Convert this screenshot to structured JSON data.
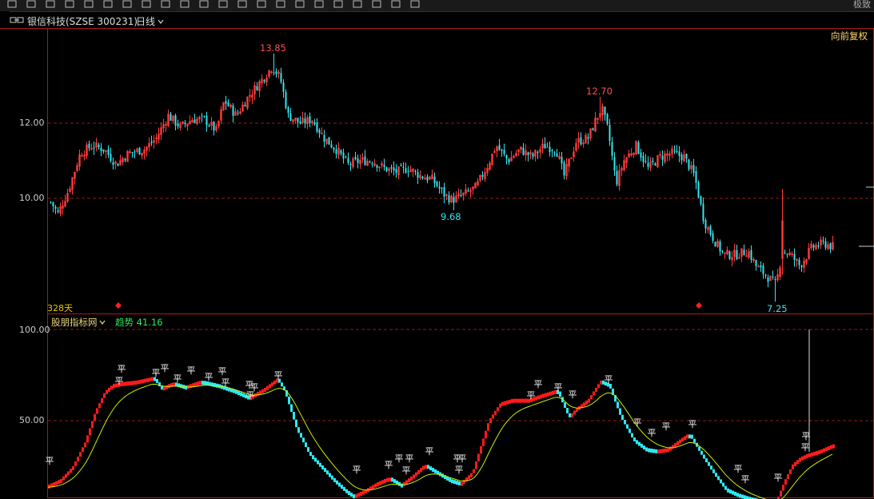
{
  "toolbar": {
    "icons": [
      "back-icon",
      "refresh-icon",
      "page-icon",
      "lines-icon",
      "flag-icon",
      "grid-icon",
      "arrow-icon",
      "tick-icon",
      "tick2-icon",
      "col-icon",
      "bars-icon",
      "stack-icon",
      "cal-icon",
      "sheet-icon",
      "diamond-icon",
      "down-icon",
      "left-icon",
      "right-icon",
      "x-icon",
      "check-icon",
      "tools-icon",
      "more-icon"
    ],
    "right_text": "极致"
  },
  "header": {
    "stock_title": "银信科技(SZSE 300231)",
    "period_label": "日线"
  },
  "main_chart": {
    "adjust_label": "向前复权",
    "y_ticks": [
      "12.00",
      "10.00"
    ],
    "days_label": "328天",
    "high_label": "13.85",
    "mid_high_label": "12.70",
    "low_label": "9.68",
    "low2_label": "7.25",
    "up_color": "#ff3b3b",
    "down_color": "#33e6f0"
  },
  "indicator": {
    "source_label": "股朋指标网",
    "trend_label": "趋势",
    "trend_value": "41.16",
    "y_ticks": [
      "100.00",
      "50.00"
    ],
    "marker_text": "平",
    "line_color": "#c8f000"
  }
}
